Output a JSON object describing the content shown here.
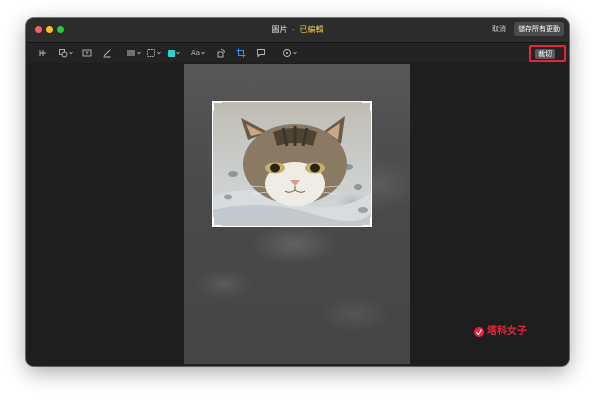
{
  "window": {
    "title": "圖片",
    "title_separator": "-",
    "title_status": "已編輯",
    "cancel_label": "取消",
    "save_all_label": "儲存所有更動"
  },
  "toolbar": {
    "tools": [
      "select-icon",
      "shapes-icon",
      "text-box-icon",
      "sign-icon",
      "line-style-icon",
      "border-color-icon",
      "fill-color-icon",
      "text-style-icon",
      "rotate-icon",
      "crop-icon",
      "note-icon",
      "share-icon"
    ],
    "fill_color": "#2ad5d5",
    "text_style_label": "Aa",
    "crop_label": "裁切",
    "crop_highlight_color": "#e8243b"
  },
  "canvas": {
    "image_subject": "cat",
    "crop_selection_visible": true
  },
  "watermark": {
    "text": "塔科女子",
    "color": "#e8243b"
  }
}
